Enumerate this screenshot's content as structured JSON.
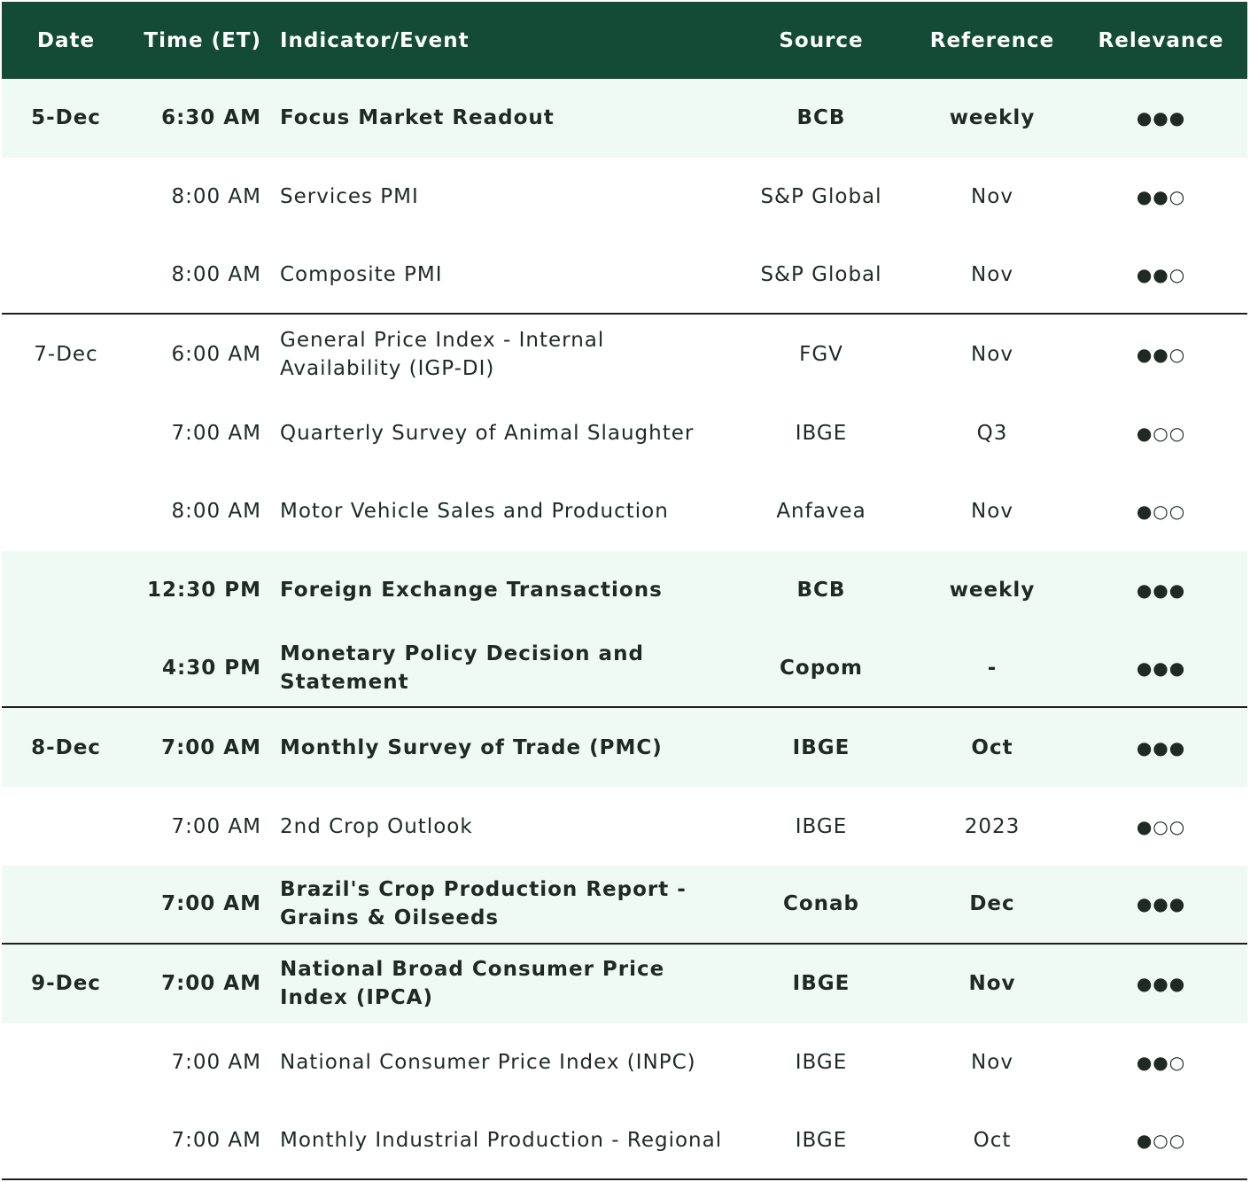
{
  "header": {
    "date": "Date",
    "time": "Time (ET)",
    "indicator": "Indicator/Event",
    "source": "Source",
    "reference": "Reference",
    "relevance": "Relevance"
  },
  "rows": [
    {
      "date": "5-Dec",
      "time": "6:30 AM",
      "indicator": "Focus Market Readout",
      "source": "BCB",
      "reference": "weekly",
      "relevance": "●●●"
    },
    {
      "date": "",
      "time": "8:00 AM",
      "indicator": "Services PMI",
      "source": "S&P Global",
      "reference": "Nov",
      "relevance": "●●○"
    },
    {
      "date": "",
      "time": "8:00 AM",
      "indicator": "Composite PMI",
      "source": "S&P Global",
      "reference": "Nov",
      "relevance": "●●○"
    },
    {
      "date": "7-Dec",
      "time": "6:00 AM",
      "indicator": "General Price Index - Internal Availability (IGP-DI)",
      "source": "FGV",
      "reference": "Nov",
      "relevance": "●●○"
    },
    {
      "date": "",
      "time": "7:00 AM",
      "indicator": "Quarterly Survey of Animal Slaughter",
      "source": "IBGE",
      "reference": "Q3",
      "relevance": "●○○"
    },
    {
      "date": "",
      "time": "8:00 AM",
      "indicator": "Motor Vehicle Sales and Production",
      "source": "Anfavea",
      "reference": "Nov",
      "relevance": "●○○"
    },
    {
      "date": "",
      "time": "12:30 PM",
      "indicator": "Foreign Exchange Transactions",
      "source": "BCB",
      "reference": "weekly",
      "relevance": "●●●"
    },
    {
      "date": "",
      "time": "4:30 PM",
      "indicator": "Monetary Policy Decision and Statement",
      "source": "Copom",
      "reference": "-",
      "relevance": "●●●"
    },
    {
      "date": "8-Dec",
      "time": "7:00 AM",
      "indicator": "Monthly Survey of Trade (PMC)",
      "source": "IBGE",
      "reference": "Oct",
      "relevance": "●●●"
    },
    {
      "date": "",
      "time": "7:00 AM",
      "indicator": "2nd Crop Outlook",
      "source": "IBGE",
      "reference": "2023",
      "relevance": "●○○"
    },
    {
      "date": "",
      "time": "7:00 AM",
      "indicator": "Brazil's Crop Production Report - Grains & Oilseeds",
      "source": "Conab",
      "reference": "Dec",
      "relevance": "●●●"
    },
    {
      "date": "9-Dec",
      "time": "7:00 AM",
      "indicator": "National Broad Consumer Price Index (IPCA)",
      "source": "IBGE",
      "reference": "Nov",
      "relevance": "●●●"
    },
    {
      "date": "",
      "time": "7:00 AM",
      "indicator": "National Consumer Price Index (INPC)",
      "source": "IBGE",
      "reference": "Nov",
      "relevance": "●●○"
    },
    {
      "date": "",
      "time": "7:00 AM",
      "indicator": "Monthly Industrial Production - Regional",
      "source": "IBGE",
      "reference": "Oct",
      "relevance": "●○○"
    }
  ]
}
